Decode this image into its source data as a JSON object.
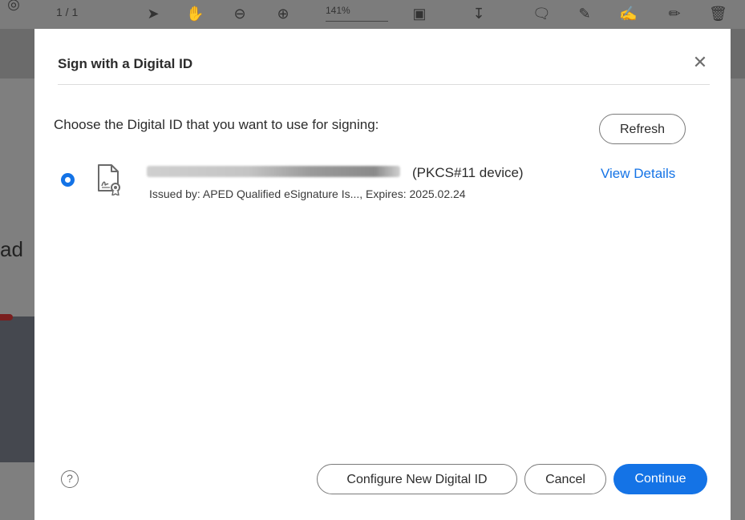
{
  "background": {
    "page_indicator": "1 / 1",
    "zoom": "141%",
    "doc_fragment": "ad"
  },
  "dialog": {
    "title": "Sign with a Digital ID",
    "close_icon": "close-icon",
    "prompt": "Choose the Digital ID that you want to use for signing:",
    "refresh_label": "Refresh",
    "digital_id": {
      "type": "(PKCS#11 device)",
      "issued": "Issued by: APED Qualified eSignature Is..., Expires: 2025.02.24",
      "selected": true,
      "view_details_label": "View Details",
      "icon": "certificate-icon"
    },
    "help_label": "?",
    "configure_label": "Configure New Digital ID",
    "cancel_label": "Cancel",
    "continue_label": "Continue",
    "colors": {
      "accent": "#1473e6",
      "overlay": "#5b5b5b"
    }
  }
}
